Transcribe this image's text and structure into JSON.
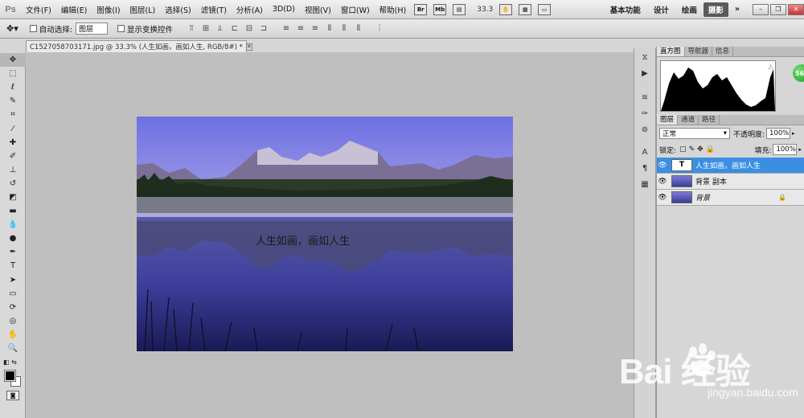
{
  "app": {
    "logo": "Ps"
  },
  "menu": [
    "文件(F)",
    "编辑(E)",
    "图像(I)",
    "图层(L)",
    "选择(S)",
    "滤镜(T)",
    "分析(A)",
    "3D(D)",
    "视图(V)",
    "窗口(W)",
    "帮助(H)"
  ],
  "menubar_icons": {
    "br": "Br",
    "mb": "Mb"
  },
  "zoom_value": "33.3",
  "workspaces": {
    "basic": "基本功能",
    "design": "设计",
    "paint": "绘画",
    "photo": "摄影",
    "more": "»"
  },
  "options": {
    "auto_select_label": "自动选择:",
    "auto_select_value": "图层",
    "show_transform_label": "显示变换控件"
  },
  "document": {
    "tab_title": "C1527058703171.jpg @ 33.3% (人生如画，画如人生, RGB/8#) *"
  },
  "canvas_text": "人生如画，画如人生",
  "histogram_panel": {
    "tabs": [
      "直方图",
      "导航器",
      "信息"
    ]
  },
  "layers_panel": {
    "tabs": [
      "图层",
      "通道",
      "路径"
    ],
    "blend_mode": "正常",
    "opacity_label": "不透明度:",
    "opacity_value": "100%",
    "lock_label": "锁定:",
    "fill_label": "填充:",
    "fill_value": "100%",
    "layers": [
      {
        "name": "人生如画，画如人生",
        "thumb": "T"
      },
      {
        "name": "背景 副本"
      },
      {
        "name": "背景"
      }
    ]
  },
  "badge": "56",
  "watermark": {
    "main": "Bai  经验",
    "sub": "jingyan.baidu.com"
  }
}
